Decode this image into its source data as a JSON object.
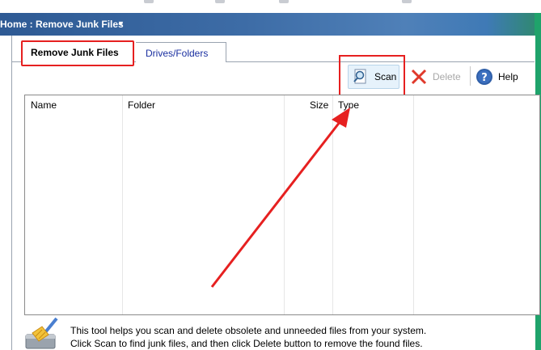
{
  "header": {
    "breadcrumb": "Home : Remove Junk Files",
    "dropdown_icon": "caret-down-icon"
  },
  "tabs": [
    {
      "label": "Remove Junk Files",
      "active": true
    },
    {
      "label": "Drives/Folders",
      "active": false
    }
  ],
  "toolbar": {
    "scan_label": "Scan",
    "delete_label": "Delete",
    "help_label": "Help",
    "scan_icon": "magnifier-document-icon",
    "delete_icon": "red-x-icon",
    "help_icon": "question-circle-icon"
  },
  "table": {
    "columns": [
      "Name",
      "Folder",
      "Size",
      "Type"
    ],
    "rows": []
  },
  "footer": {
    "icon": "broom-cleaner-icon",
    "line1": "This tool helps you scan and delete obsolete and unneeded files from your system.",
    "line2": "Click Scan to find junk files, and then click Delete button to remove the found files."
  },
  "colors": {
    "annotation": "#e62020",
    "title_bar": "#3d6ca6",
    "tab_link": "#1a2fa0",
    "accent_green": "#1fa36b"
  }
}
